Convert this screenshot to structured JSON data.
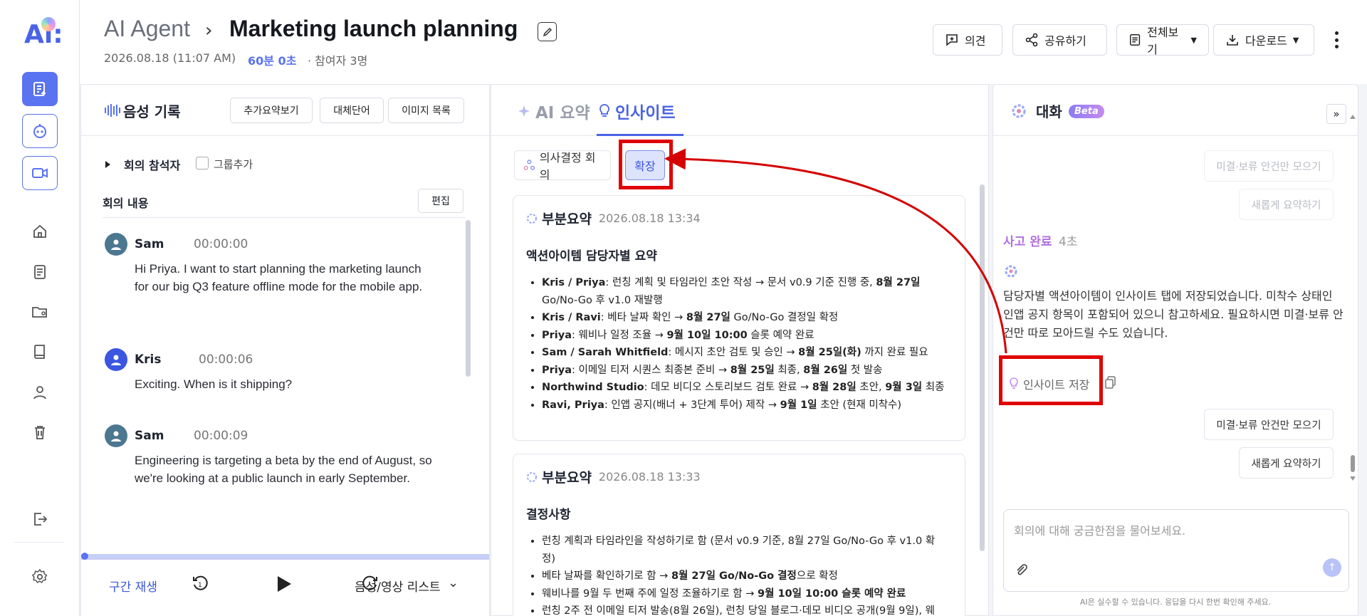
{
  "colors": {
    "accent": "#5a73f0",
    "highlight": "#e00000",
    "purple": "#b26ee0"
  },
  "rail": {
    "logo": "Ai:",
    "icons": [
      "new-note-icon",
      "ai-bot-icon",
      "video-record-icon",
      "home-icon",
      "document-icon",
      "folder-share-icon",
      "book-icon",
      "user-icon",
      "trash-icon",
      "logout-icon",
      "settings-icon"
    ]
  },
  "header": {
    "breadcrumb": "AI Agent",
    "title": "Marketing launch planning",
    "date": "2026.08.18 (11:07 AM)",
    "duration": "60분 0초",
    "participants": "· 참여자 3명",
    "buttons": {
      "opinion": "의견",
      "share": "공유하기",
      "view_all": "전체보기",
      "download": "다운로드"
    }
  },
  "left": {
    "title": "음성 기록",
    "buttons": [
      "추가요약보기",
      "대체단어",
      "이미지 목록"
    ],
    "participants_label": "회의 참석자",
    "group_add": "그룹추가",
    "content_label": "회의 내용",
    "edit": "편집",
    "messages": [
      {
        "name": "Sam",
        "time": "00:00:00",
        "text": "Hi Priya. I want to start planning the marketing launch for our big Q3 feature offline mode for the mobile app."
      },
      {
        "name": "Kris",
        "time": "00:00:06",
        "text": "Exciting. When is it shipping?"
      },
      {
        "name": "Sam",
        "time": "00:00:09",
        "text": "Engineering is targeting a beta by the end of August, so we're looking at a public launch in early September."
      }
    ],
    "player": {
      "segment": "구간 재생",
      "list": "음성/영상 리스트"
    }
  },
  "mid": {
    "tabs": {
      "summary": "AI 요약",
      "insight": "인사이트"
    },
    "chips": {
      "decision": "의사결정 회의",
      "expand": "확장"
    },
    "card1": {
      "title": "부분요약",
      "date": "2026.08.18 13:34",
      "subtitle": "액션아이템 담당자별 요약",
      "items": [
        {
          "who": "Kris / Priya",
          "text": ": 런칭 계획 및 타임라인 초안 작성 → 문서 v0.9 기준 진행 중, ",
          "bold": "8월 27일",
          "tail": " Go/No-Go 후 v1.0 재발행"
        },
        {
          "who": "Kris / Ravi",
          "text": ": 베타 날짜 확인 → ",
          "bold": "8월 27일",
          "tail": " Go/No-Go 결정일 확정"
        },
        {
          "who": "Priya",
          "text": ": 웨비나 일정 조율 → ",
          "bold": "9월 10일 10:00",
          "tail": " 슬롯 예약 완료"
        },
        {
          "who": "Sam / Sarah Whitfield",
          "text": ": 메시지 초안 검토 및 승인 → ",
          "bold": "8월 25일(화)",
          "tail": " 까지 완료 필요"
        },
        {
          "who": "Priya",
          "text": ": 이메일 티저 시퀀스 최종본 준비 → ",
          "bold": "8월 25일",
          "tail": " 최종, ",
          "bold2": "8월 26일",
          "tail2": " 첫 발송"
        },
        {
          "who": "Northwind Studio",
          "text": ": 데모 비디오 스토리보드 검토 완료 → ",
          "bold": "8월 28일",
          "tail": " 초안, ",
          "bold2": "9월 3일",
          "tail2": " 최종"
        },
        {
          "who": "Ravi, Priya",
          "text": ": 인앱 공지(배너 + 3단계 투어) 제작 → ",
          "bold": "9월 1일",
          "tail": " 초안 (현재 미착수)"
        }
      ]
    },
    "card2": {
      "title": "부분요약",
      "date": "2026.08.18 13:33",
      "subtitle": "결정사항",
      "items": [
        {
          "text": "런칭 계획과 타임라인을 작성하기로 함 (문서 v0.9 기준, 8월 27일 Go/No-Go 후 v1.0 확정)"
        },
        {
          "text": "베타 날짜를 확인하기로 함 → ",
          "bold": "8월 27일 Go/No-Go 결정",
          "tail": "으로 확정"
        },
        {
          "text": "웨비나를 9월 두 번째 주에 일정 조율하기로 함 → ",
          "bold": "9월 10일 10:00 슬롯 예약 완료",
          "tail": ""
        },
        {
          "text": "런칭 2주 전 이메일 티저 발송(8월 26일), 런칭 당일 블로그·데모 비디오 공개(9월 9일), 웨"
        }
      ]
    }
  },
  "right": {
    "title": "대화",
    "beta": "Beta",
    "faded_buttons": [
      "미결·보류 안건만 모으기",
      "새롭게 요약하기"
    ],
    "think": "사고 완료",
    "think_time": "4초",
    "message": "담당자별 액션아이템이 인사이트 탭에 저장되었습니다. 미착수 상태인 인앱 공지 항목이 포함되어 있으니 참고하세요. 필요하시면 미결·보류 안건만 따로 모아드릴 수도 있습니다.",
    "save_insight": "인사이트 저장",
    "buttons": [
      "미결·보류 안건만 모으기",
      "새롭게 요약하기"
    ],
    "input_placeholder": "회의에 대해 궁금한점을 물어보세요.",
    "disclaimer": "AI은 실수할 수 있습니다. 응답을 다시 한번 확인해 주세요."
  }
}
